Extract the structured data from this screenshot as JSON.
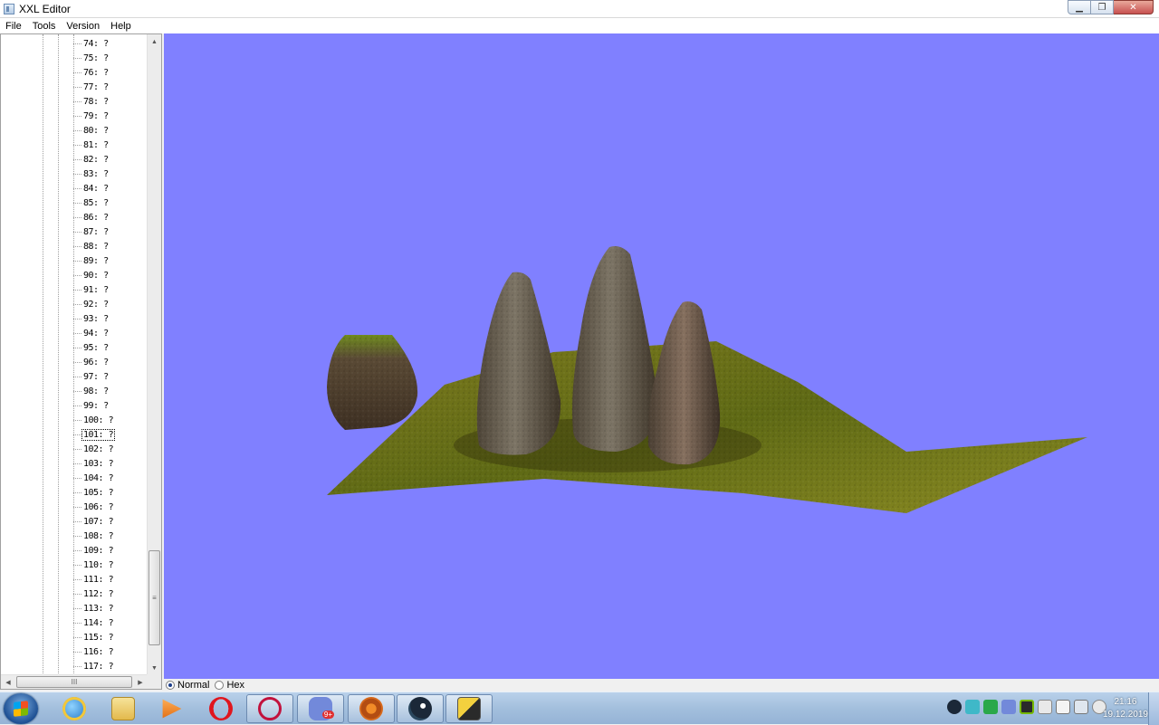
{
  "window": {
    "title": "XXL Editor"
  },
  "window_controls": {
    "minimize": "▁",
    "maximize": "❐",
    "close": "✕"
  },
  "menu": [
    "File",
    "Tools",
    "Version",
    "Help"
  ],
  "tree": {
    "items": [
      "74: ?",
      "75: ?",
      "76: ?",
      "77: ?",
      "78: ?",
      "79: ?",
      "80: ?",
      "81: ?",
      "82: ?",
      "83: ?",
      "84: ?",
      "85: ?",
      "86: ?",
      "87: ?",
      "88: ?",
      "89: ?",
      "90: ?",
      "91: ?",
      "92: ?",
      "93: ?",
      "94: ?",
      "95: ?",
      "96: ?",
      "97: ?",
      "98: ?",
      "99: ?",
      "100: ?",
      "101: ?",
      "102: ?",
      "103: ?",
      "104: ?",
      "105: ?",
      "106: ?",
      "107: ?",
      "108: ?",
      "109: ?",
      "110: ?",
      "111: ?",
      "112: ?",
      "113: ?",
      "114: ?",
      "115: ?",
      "116: ?",
      "117: ?"
    ],
    "selected": "101: ?",
    "scroll_up": "▲",
    "scroll_down": "▼",
    "scroll_grip": "≡",
    "scroll_left": "◀",
    "scroll_right": "▶",
    "hscroll_grip": "III"
  },
  "viewport": {
    "background": "#8080ff"
  },
  "radio": {
    "normal": "Normal",
    "hex": "Hex",
    "selected": "Normal"
  },
  "taskbar": {
    "pinned": [
      "internet-explorer-icon",
      "file-explorer-icon",
      "media-player-icon",
      "opera-icon"
    ],
    "open": [
      "opera-gx-icon",
      "discord-icon",
      "tf2-icon",
      "steam-icon",
      "xxl-editor-icon"
    ],
    "discord_badge": "9+"
  },
  "clock": {
    "time": "21:16",
    "date": "19.12.2019"
  }
}
